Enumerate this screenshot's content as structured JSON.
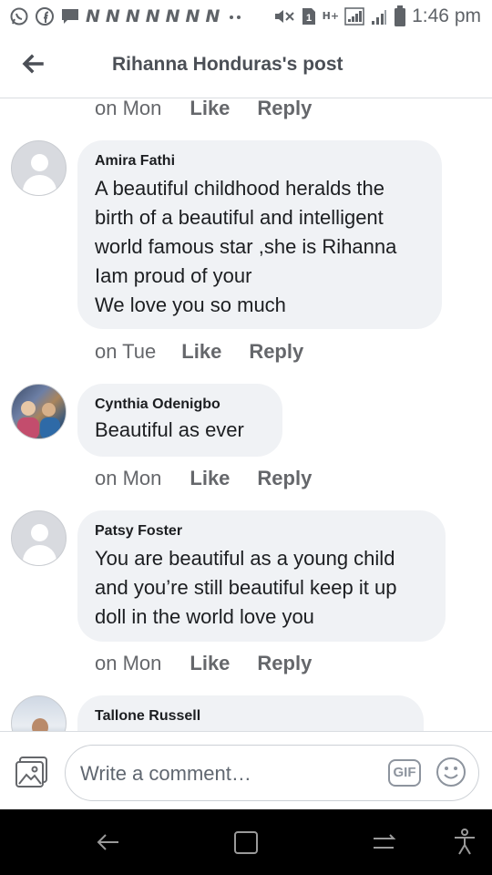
{
  "status_bar": {
    "time": "1:46 pm",
    "notification_letter": "N",
    "sim_number": "1",
    "network": "H+"
  },
  "header": {
    "title": "Rihanna Honduras's post"
  },
  "comments": [
    {
      "author": "",
      "text": "",
      "time": "on Mon",
      "like": "Like",
      "reply": "Reply"
    },
    {
      "author": "Amira Fathi",
      "text": "A beautiful childhood heralds the\nbirth of a beautiful and intelligent\nworld famous star ,she is Rihanna\nIam proud of your\nWe love you so much",
      "time": "on Tue",
      "like": "Like",
      "reply": "Reply"
    },
    {
      "author": "Cynthia Odenigbo",
      "text": "Beautiful as ever",
      "time": "on Mon",
      "like": "Like",
      "reply": "Reply"
    },
    {
      "author": "Patsy Foster",
      "text": "You are beautiful as a young child\nand you’re still beautiful keep it up\ndoll in the world love you",
      "time": "on Mon",
      "like": "Like",
      "reply": "Reply"
    },
    {
      "author": "Tallone Russell",
      "text": ""
    }
  ],
  "composer": {
    "placeholder": "Write a comment…",
    "gif_label": "GIF"
  },
  "icons": {
    "back": "arrow-left-icon",
    "photo": "photo-icon",
    "emoji": "emoji-icon",
    "nav_back": "nav-back-icon",
    "nav_recents": "recents-icon",
    "nav_home": "home-icon",
    "accessibility": "accessibility-icon"
  },
  "colors": {
    "bubble": "#f0f2f5",
    "meta_text": "#65676b",
    "nav_bar": "#000000"
  }
}
